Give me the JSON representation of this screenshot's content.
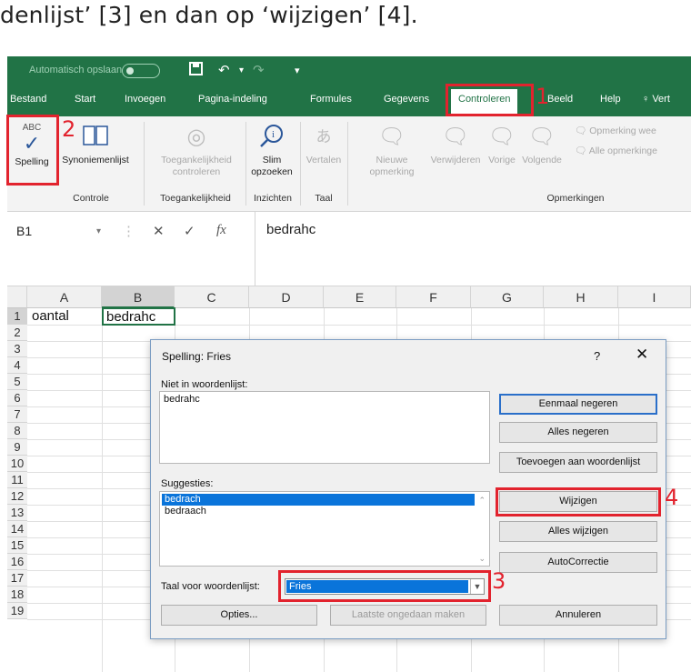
{
  "caption": "denlijst’ [3] en dan op ‘wijzigen’ [4].",
  "titlebar": {
    "autosave_label": "Automatisch opslaan",
    "save_icon": "floppy-disk-icon",
    "undo_icon": "undo-icon",
    "redo_icon": "redo-icon"
  },
  "tabs": [
    "Bestand",
    "Start",
    "Invoegen",
    "Pagina-indeling",
    "Formules",
    "Gegevens",
    "Controleren",
    "Beeld",
    "Help",
    "Vert"
  ],
  "active_tab": "Controleren",
  "ribbon": {
    "spelling_abc": "ABC",
    "spelling": "Spelling",
    "synonyms": "Synoniemenlijst",
    "accessibility_1": "Toegankelijkheid",
    "accessibility_2": "controleren",
    "smart_1": "Slim",
    "smart_2": "opzoeken",
    "translate": "Vertalen",
    "new_comment_1": "Nieuwe",
    "new_comment_2": "opmerking",
    "delete": "Verwijderen",
    "previous": "Vorige",
    "next": "Volgende",
    "show_comment": "Opmerking wee",
    "all_comments": "Alle opmerkinge",
    "groups": {
      "controle": "Controle",
      "accessibility": "Toegankelijkheid",
      "insights": "Inzichten",
      "language": "Taal",
      "comments": "Opmerkingen"
    }
  },
  "formula_bar": {
    "cell_ref": "B1",
    "value": "bedrahc"
  },
  "sheet": {
    "columns": [
      "A",
      "B",
      "C",
      "D",
      "E",
      "F",
      "G",
      "H",
      "I"
    ],
    "rows": [
      "1",
      "2",
      "3",
      "4",
      "5",
      "6",
      "7",
      "8",
      "9",
      "10",
      "11",
      "12",
      "13",
      "14",
      "15",
      "16",
      "17",
      "18",
      "19"
    ],
    "a1": "oantal",
    "b1": "bedrahc"
  },
  "dialog": {
    "title": "Spelling: Fries",
    "help": "?",
    "close": "✕",
    "not_in_dict_label": "Niet in woordenlijst:",
    "not_in_dict_value": "bedrahc",
    "suggestions_label": "Suggesties:",
    "suggestions": [
      "bedrach",
      "bedraach"
    ],
    "dict_lang_label": "Taal voor woordenlijst:",
    "dict_lang_value": "Fries",
    "buttons": {
      "ignore_once": "Eenmaal negeren",
      "ignore_all": "Alles negeren",
      "add_to_dict": "Toevoegen aan woordenlijst",
      "change": "Wijzigen",
      "change_all": "Alles wijzigen",
      "autocorrect": "AutoCorrectie",
      "options": "Opties...",
      "undo_last": "Laatste ongedaan maken",
      "cancel": "Annuleren"
    }
  },
  "markers": [
    "1",
    "2",
    "3",
    "4"
  ],
  "colors": {
    "excel_green": "#217346",
    "highlight_red": "#e2232e",
    "selection_blue": "#0a74da"
  }
}
